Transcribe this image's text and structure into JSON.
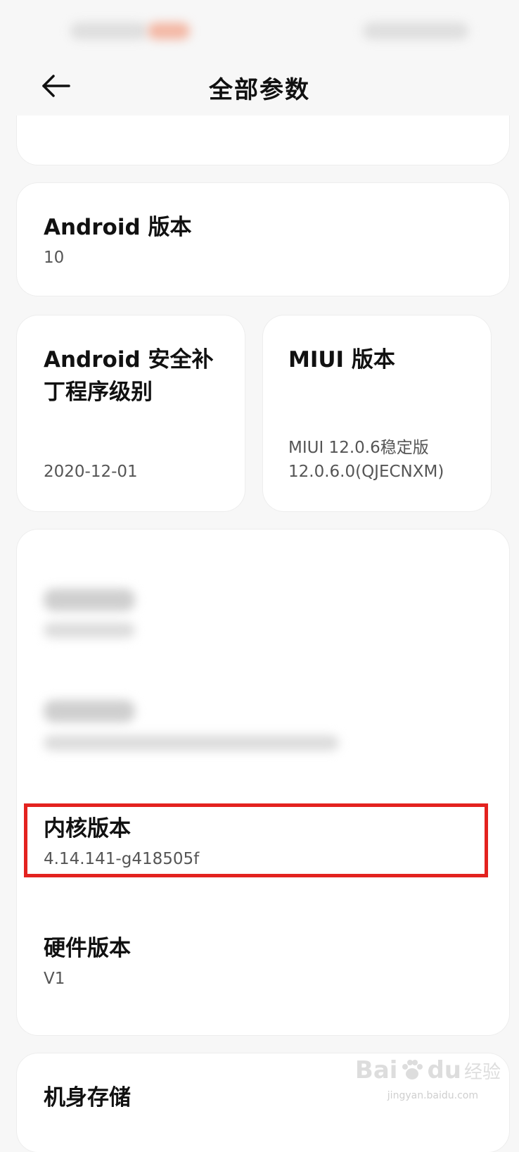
{
  "header": {
    "title": "全部参数",
    "back_icon": "arrow-left-icon"
  },
  "cards": {
    "android_version": {
      "title": "Android 版本",
      "value": "10"
    },
    "security_patch": {
      "title_line1": "Android 安全补",
      "title_line2": "丁程序级别",
      "value": "2020-12-01"
    },
    "miui_version": {
      "title": "MIUI 版本",
      "value_line1": "MIUI 12.0.6稳定版",
      "value_line2": "12.0.6.0(QJECNXM)"
    },
    "kernel_version": {
      "title": "内核版本",
      "value": "4.14.141-g418505f"
    },
    "hardware_version": {
      "title": "硬件版本",
      "value": "V1"
    },
    "storage": {
      "title": "机身存储"
    }
  },
  "watermark": {
    "brand": "Bai",
    "brand_du": "du",
    "cn": "经验",
    "url": "jingyan.baidu.com"
  },
  "colors": {
    "highlight": "#e3221f",
    "background": "#f7f7f7",
    "card": "#ffffff"
  }
}
